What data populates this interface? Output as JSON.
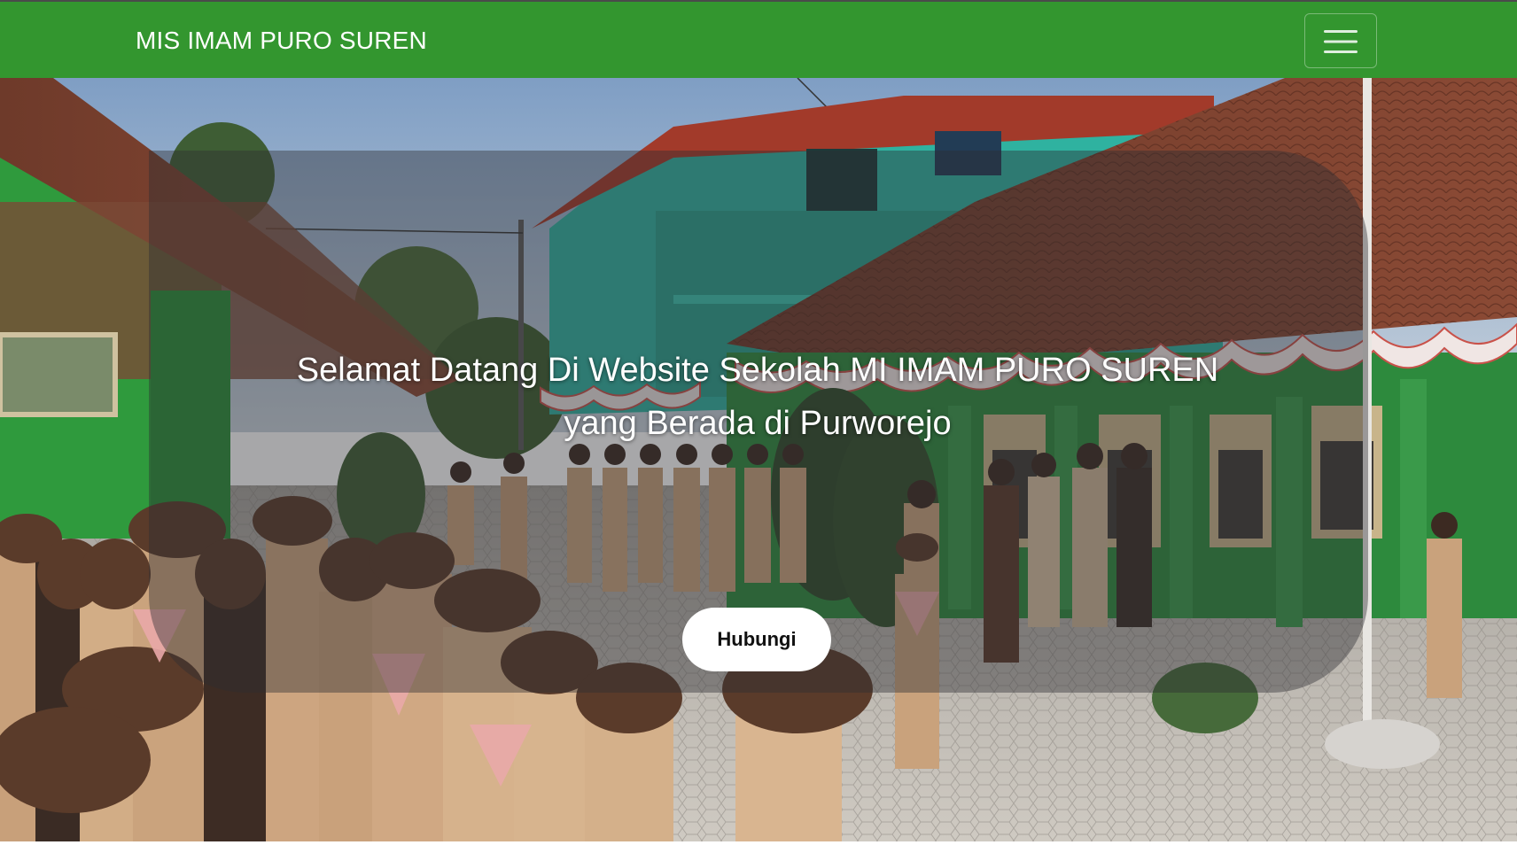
{
  "navbar": {
    "brand": "MIS IMAM PURO SUREN",
    "menu_icon": "hamburger-menu-icon",
    "bg_color": "#33962f"
  },
  "hero": {
    "title_line1": "Selamat Datang Di Website Sekolah MI IMAM PURO SUREN",
    "title_line2": "yang Berada di Purworejo",
    "button_label": "Hubungi",
    "background_image": "school-courtyard-scout-ceremony-photo"
  }
}
